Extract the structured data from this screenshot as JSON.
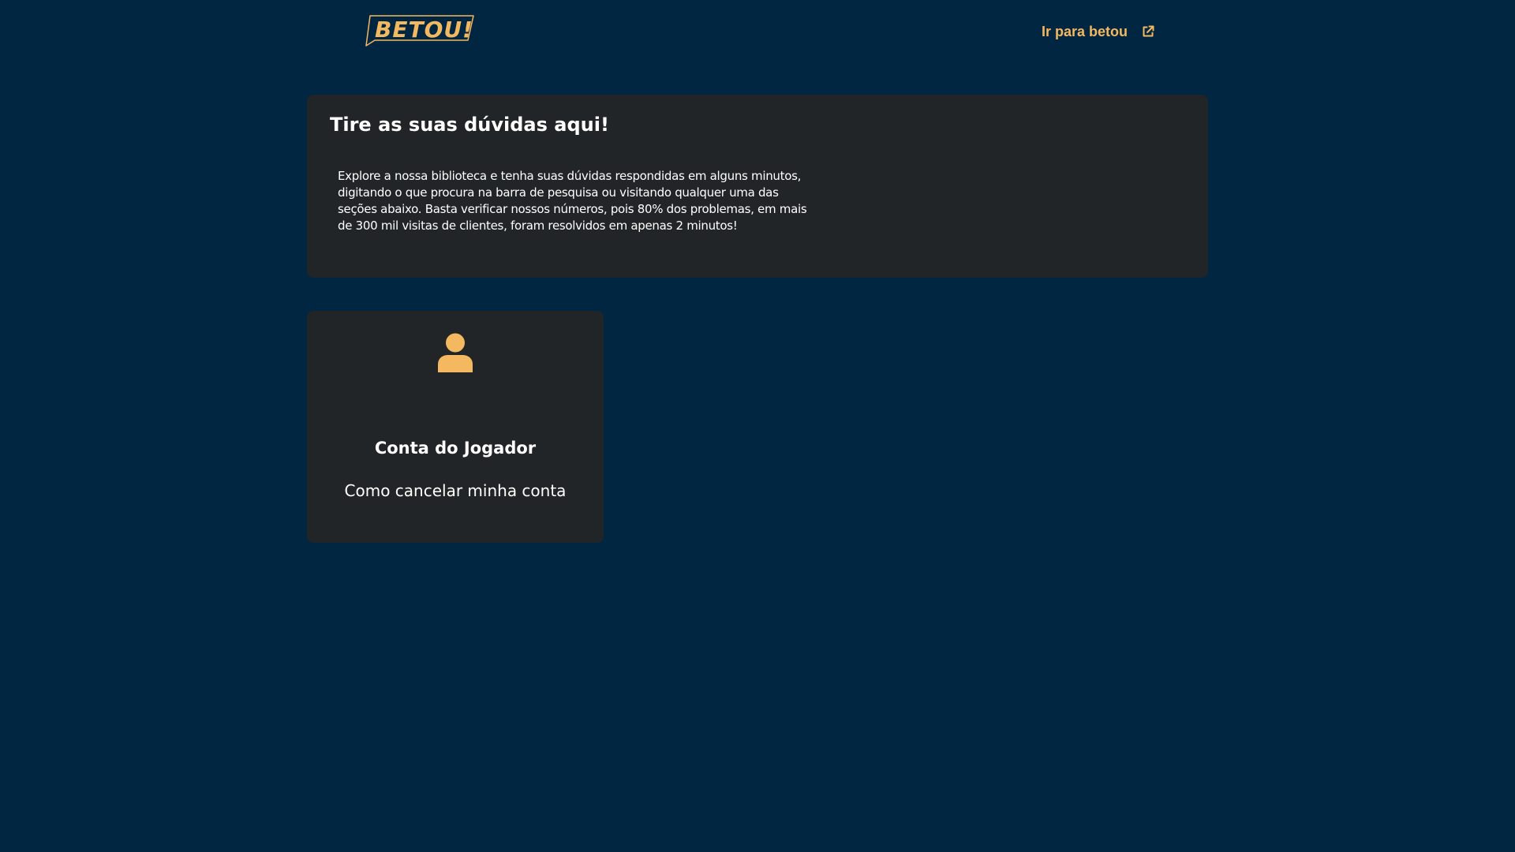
{
  "header": {
    "logo_text": "BETOU!",
    "external_link_label": "Ir para betou",
    "external_link_icon": "external-link-icon"
  },
  "hero": {
    "title": "Tire as suas dúvidas aqui!",
    "description": "Explore a nossa biblioteca e tenha suas dúvidas respondidas em alguns minutos, digitando o que procura na barra de pesquisa ou visitando qualquer uma das seções abaixo. Basta verificar nossos números, pois 80% dos problemas, em mais de 300 mil visitas de clientes, foram resolvidos em apenas 2 minutos!"
  },
  "categories": [
    {
      "icon": "user-icon",
      "title": "Conta do Jogador",
      "articles": [
        "Como cancelar minha conta"
      ]
    }
  ],
  "colors": {
    "background": "#012641",
    "card": "#222527",
    "accent": "#f4b860",
    "text": "#ffffff"
  }
}
